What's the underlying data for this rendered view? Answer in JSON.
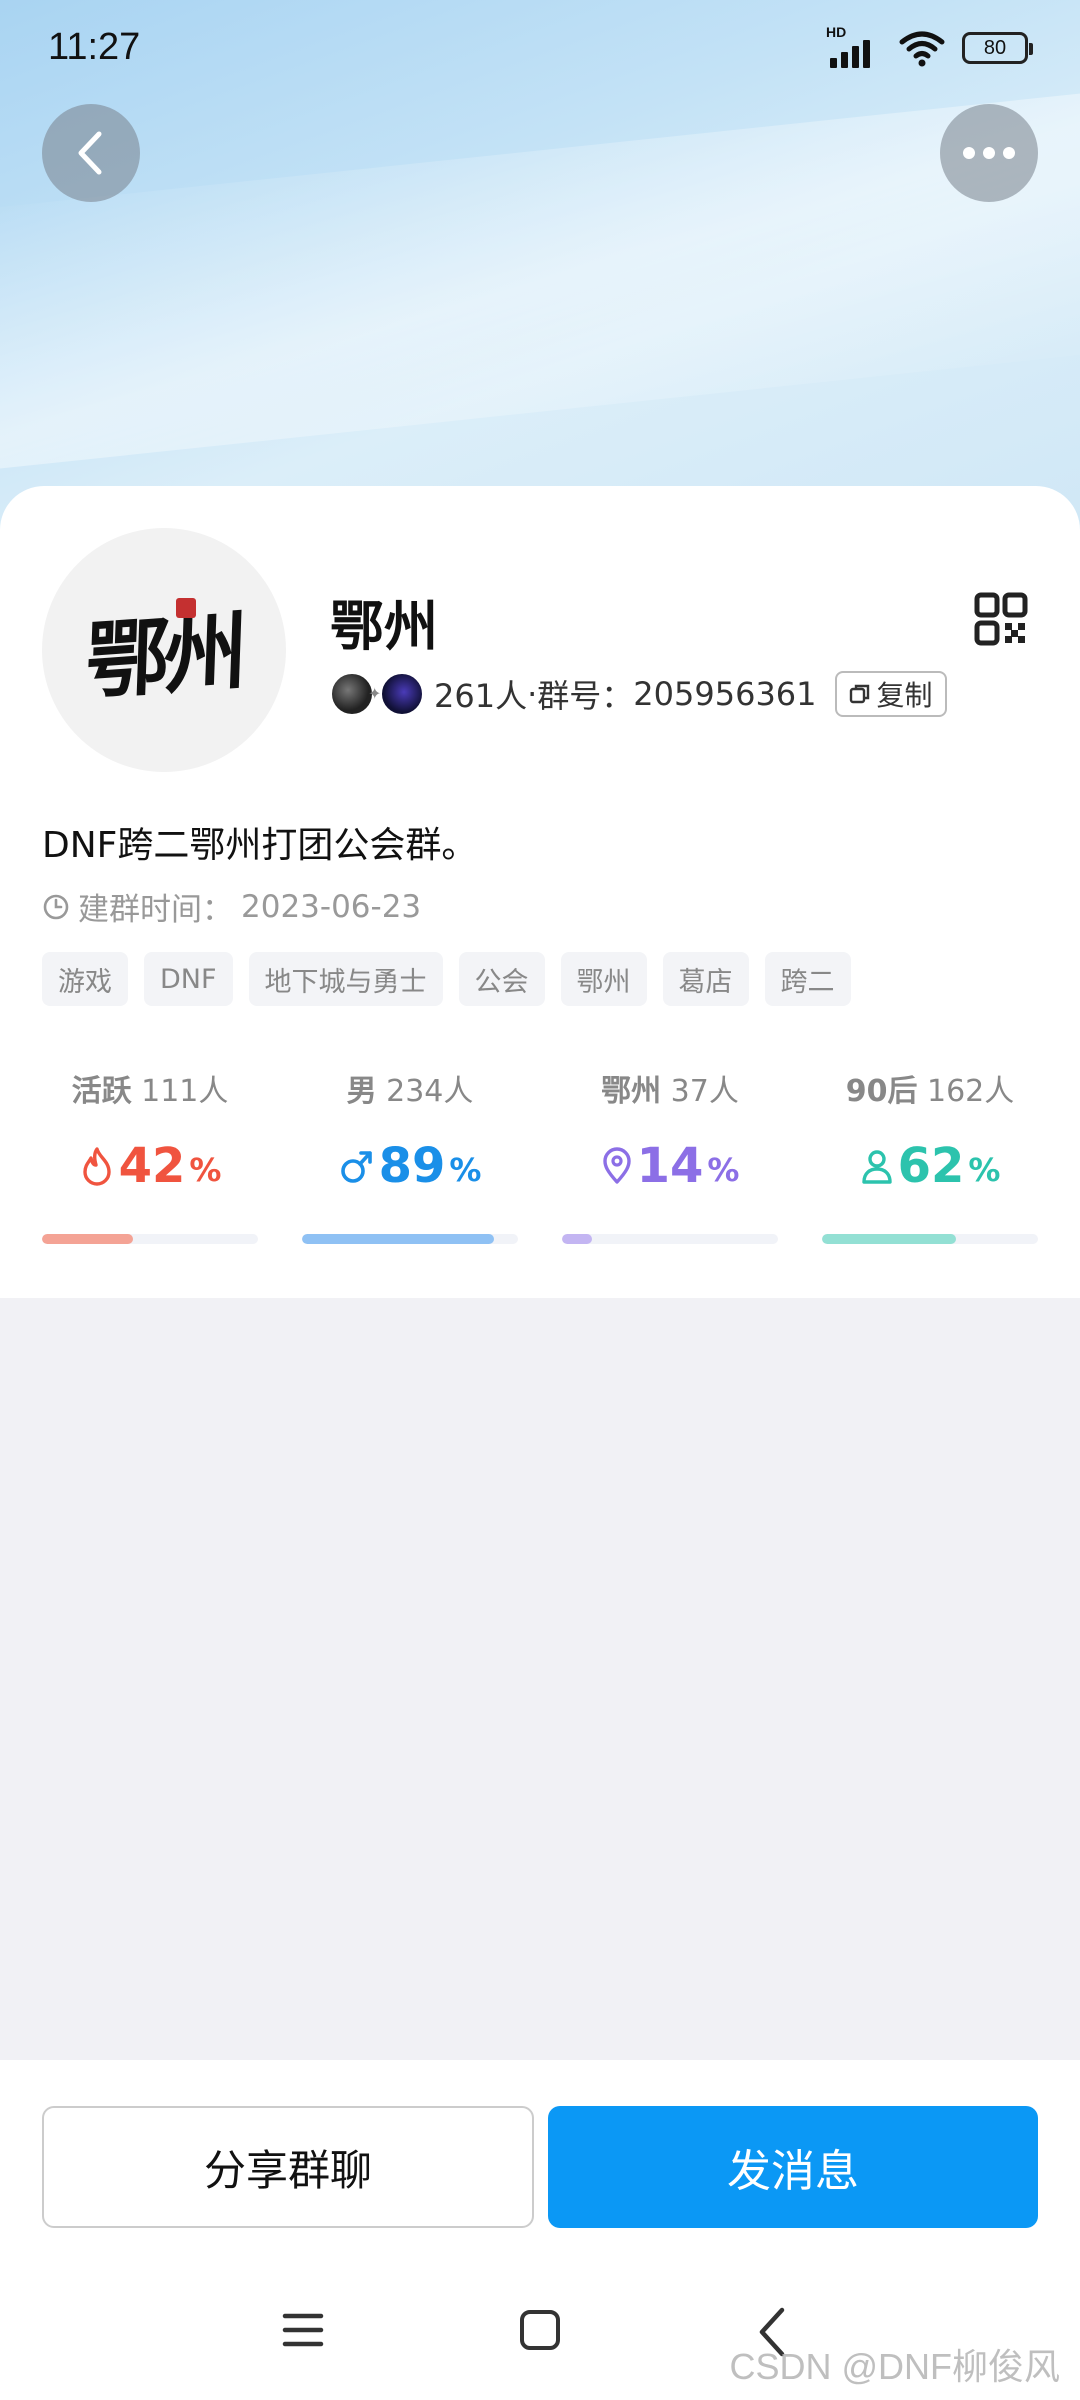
{
  "status_bar": {
    "time": "11:27",
    "hd": "HD",
    "battery": "80"
  },
  "group": {
    "name": "鄂州",
    "avatar_text": "鄂州",
    "member_count": "261人",
    "separator": " · ",
    "group_no_label": "群号：",
    "group_no": "205956361",
    "copy_label": "复制",
    "description": "DNF跨二鄂州打团公会群。",
    "created_label": "建群时间：",
    "created_date": "2023-06-23"
  },
  "tags": [
    "游戏",
    "DNF",
    "地下城与勇士",
    "公会",
    "鄂州",
    "葛店",
    "跨二"
  ],
  "stats": [
    {
      "label_bold": "活跃",
      "label_rest": " 111人",
      "value": "42",
      "unit": "%",
      "fraction": 0.42,
      "color": "#f0543f",
      "bar_color": "#f4a395",
      "icon": "fire-icon"
    },
    {
      "label_bold": "男",
      "label_rest": " 234人",
      "value": "89",
      "unit": "%",
      "fraction": 0.89,
      "color": "#1a8fe8",
      "bar_color": "#8fc1f4",
      "icon": "male-icon"
    },
    {
      "label_bold": "鄂州",
      "label_rest": " 37人",
      "value": "14",
      "unit": "%",
      "fraction": 0.14,
      "color": "#8c6fe6",
      "bar_color": "#c3b5f2",
      "icon": "location-icon"
    },
    {
      "label_bold": "90后",
      "label_rest": " 162人",
      "value": "62",
      "unit": "%",
      "fraction": 0.62,
      "color": "#2cc3ad",
      "bar_color": "#93e0d4",
      "icon": "person-icon"
    }
  ],
  "actions": {
    "share_label": "分享群聊",
    "send_label": "发消息"
  },
  "watermark": "CSDN @DNF柳俊风"
}
